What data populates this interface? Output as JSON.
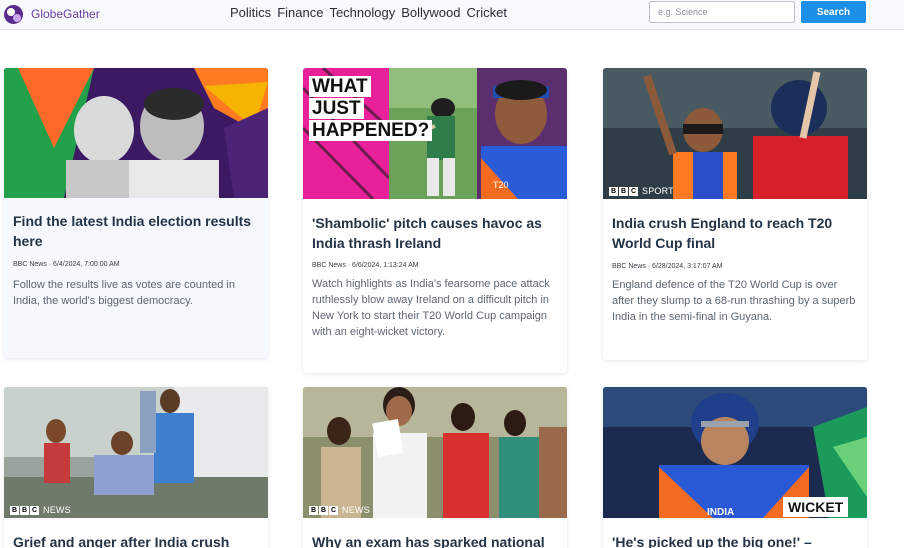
{
  "brand": {
    "name": "GlobeGather",
    "logo_icon": "globe-logo-icon"
  },
  "nav": [
    "Politics",
    "Finance",
    "Technology",
    "Bollywood",
    "Cricket"
  ],
  "search": {
    "placeholder": "e.g. Science",
    "value": "",
    "button_label": "Search"
  },
  "cards": [
    {
      "title": "Find the latest India election results here",
      "meta": "BBC News · 6/4/2024, 7:00:00 AM",
      "description": "Follow the results live as votes are counted in India, the world's biggest democracy.",
      "image_alt": "Narendra Modi and Rahul Gandhi portraits on a purple, orange and green background"
    },
    {
      "title": "'Shambolic' pitch causes havoc as India thrash Ireland",
      "meta": "BBC News · 6/6/2024, 1:13:24 AM",
      "description": "Watch highlights as India's fearsome pace attack ruthlessly blow away Ireland on a difficult pitch in New York to start their T20 World Cup campaign with an eight-wicket victory.",
      "image_caption": "WHAT JUST HAPPENED?",
      "image_alt": "An Ireland batter and a smiling India player at the T20 World Cup"
    },
    {
      "title": "India crush England to reach T20 World Cup final",
      "meta": "BBC News · 6/28/2024, 3:17:07 AM",
      "description": "England defence of the T20 World Cup is over after they slump to a 68-run thrashing by a superb India in the semi-final in Guyana.",
      "image_badge": "SPORT",
      "image_alt": "An India player celebrating in front of an England player"
    },
    {
      "title": "Grief and anger after India crush",
      "image_badge": "NEWS",
      "image_alt": "People helping a distressed man beside a van"
    },
    {
      "title": "Why an exam has sparked national",
      "image_badge": "NEWS",
      "image_alt": "Students walking outside an exam centre"
    },
    {
      "title": "'He's picked up the big one!' –",
      "image_caption": "WICKET",
      "image_alt": "India captain wearing a helmet in a blue India shirt"
    }
  ],
  "colors": {
    "accent": "#1b8ee6",
    "brand": "#6a3da5",
    "title": "#243447"
  }
}
